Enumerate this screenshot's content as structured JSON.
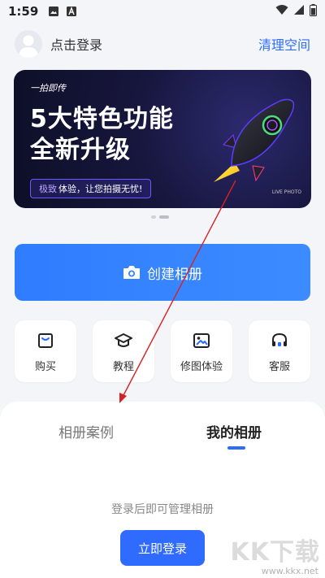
{
  "status_bar": {
    "time": "1:59"
  },
  "header": {
    "login_prompt": "点击登录",
    "clear_space": "清理空间"
  },
  "banner": {
    "brand": "一拍即传",
    "title_line1": "5大特色功能",
    "title_line2": "全新升级",
    "chip_highlight": "极致",
    "chip_text": "体验，让您拍摄无忧!",
    "tag": "LIVE PHOTO"
  },
  "create_album": {
    "label": "创建相册"
  },
  "functions": [
    {
      "label": "购买",
      "icon": "shopping-bag-icon"
    },
    {
      "label": "教程",
      "icon": "graduation-cap-icon"
    },
    {
      "label": "修图体验",
      "icon": "image-icon"
    },
    {
      "label": "客服",
      "icon": "headset-icon"
    }
  ],
  "sheet": {
    "tabs": [
      {
        "label": "相册案例",
        "active": false
      },
      {
        "label": "我的相册",
        "active": true
      }
    ],
    "empty_message": "登录后即可管理相册",
    "login_button": "立即登录"
  },
  "watermark": {
    "text": "KK下载",
    "url": "www.kkx.net"
  },
  "colors": {
    "accent": "#2e6cff",
    "banner_bg": "#17163d",
    "annotation": "#d62222"
  }
}
